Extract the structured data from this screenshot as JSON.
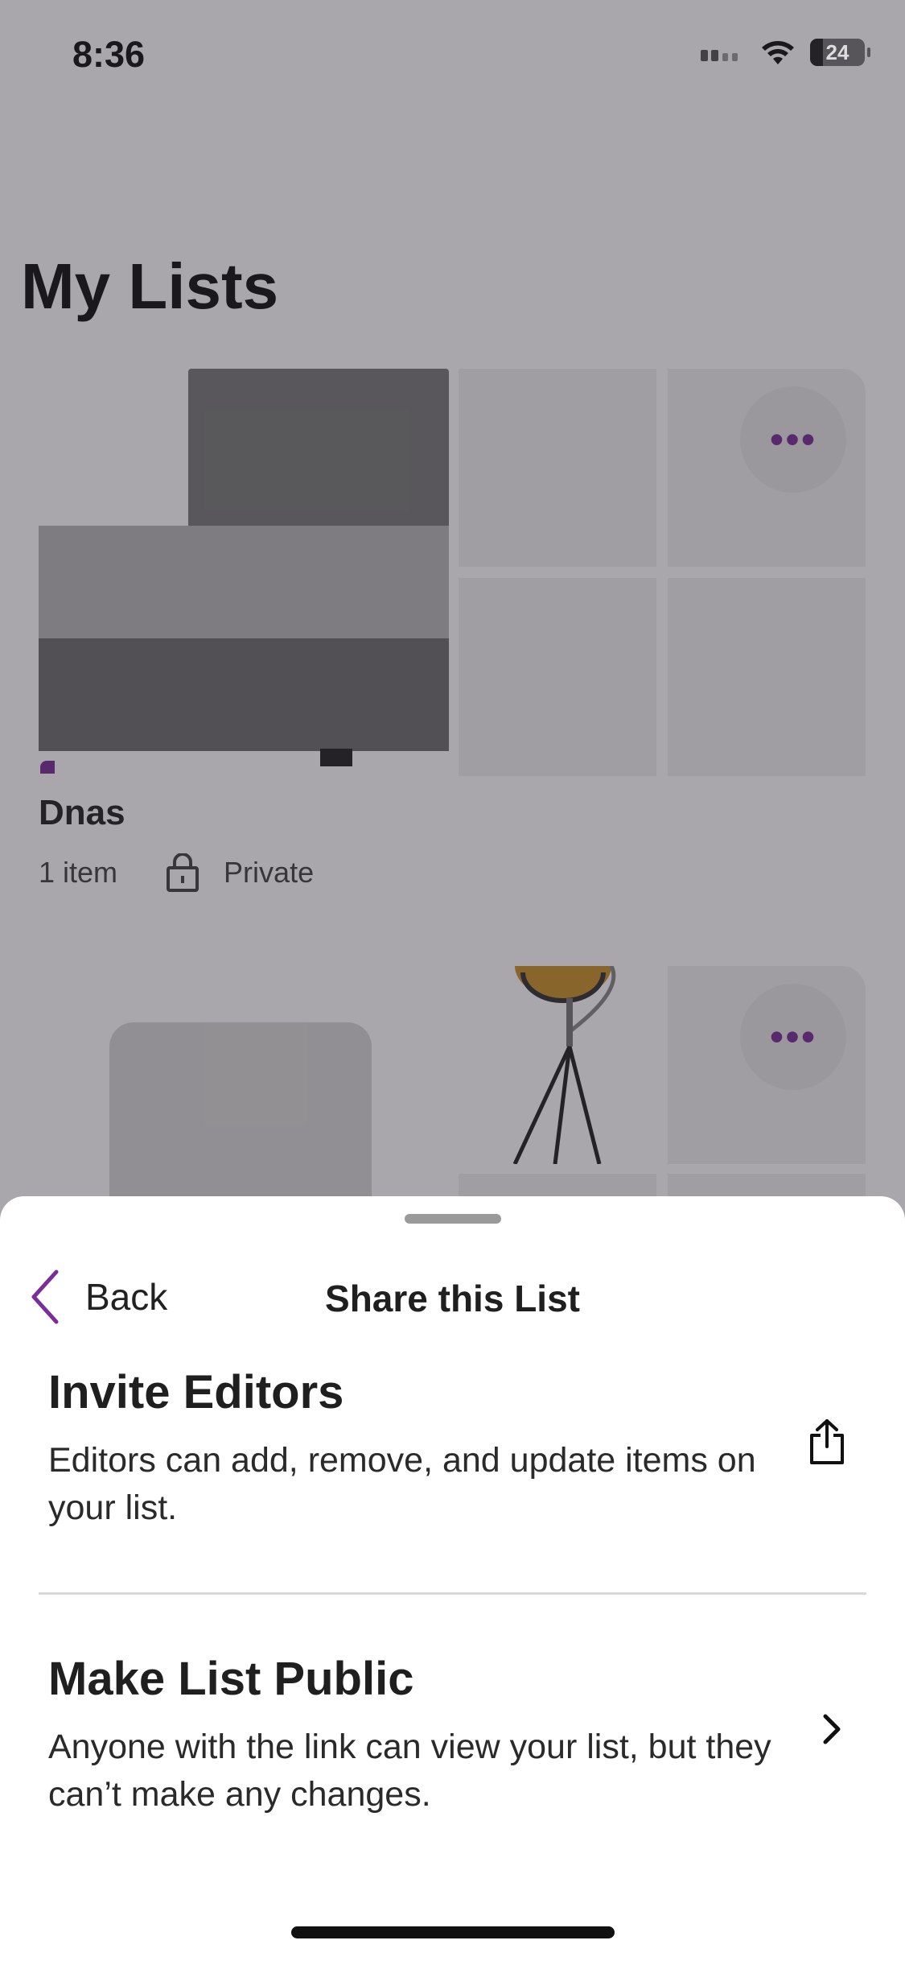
{
  "status_bar": {
    "time": "8:36",
    "battery": "24",
    "battery_level": 0.24
  },
  "page": {
    "title": "My Lists"
  },
  "list_1": {
    "name": "Dnas",
    "count": "1 item",
    "privacy": "Private"
  },
  "sheet": {
    "back_label": "Back",
    "title": "Share this List",
    "invite": {
      "heading": "Invite Editors",
      "description": "Editors can add, remove, and update items on your list."
    },
    "public": {
      "heading": "Make List Public",
      "description": "Anyone with the link can view your list, but they can’t make any changes."
    }
  },
  "colors": {
    "accent": "#7b2d99",
    "overlay": "rgba(40,36,44,0.40)"
  },
  "icons": [
    "cellular-icon",
    "wifi-icon",
    "battery-icon",
    "more-icon",
    "lock-icon",
    "chevron-left-icon",
    "share-icon",
    "chevron-right-icon"
  ]
}
